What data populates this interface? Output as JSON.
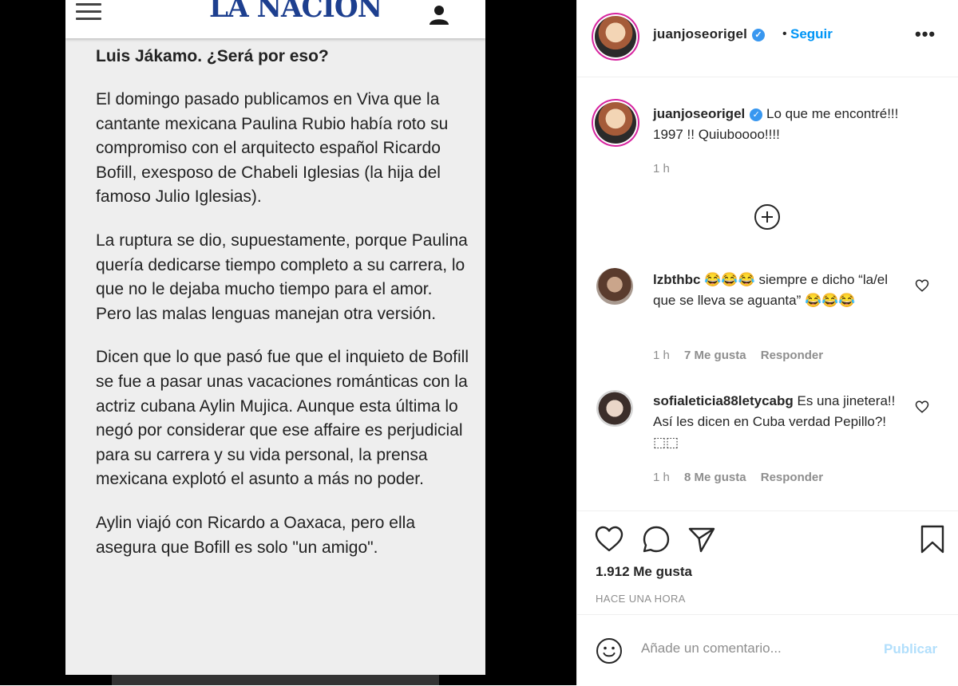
{
  "post_image": {
    "logo": "LA NACIÓN",
    "article": {
      "title": "Luis Jákamo. ¿Será por eso?",
      "paragraphs": [
        "El domingo pasado publicamos en Viva que la cantante mexicana Paulina Rubio había roto su compromiso con el arquitecto español Ricardo Bofill, exesposo de Chabeli Iglesias (la hija del famoso Julio Iglesias).",
        "La ruptura se dio, supuestamente, porque Paulina quería dedicarse tiempo completo a su carrera, lo que no le dejaba mucho tiempo para el amor. Pero las malas lenguas manejan otra versión.",
        "Dicen que lo que pasó fue que el inquieto de Bofill se fue a pasar unas vacaciones románticas con la actriz cubana Aylin Mujica. Aunque esta última lo negó por considerar que ese affaire es perjudicial para su carrera y su vida personal, la prensa mexicana explotó el asunto a más no poder.",
        "Aylin viajó con Ricardo a Oaxaca, pero ella asegura que Bofill es solo \"un amigo\"."
      ]
    }
  },
  "header": {
    "username": "juanjoseorigel",
    "verified_icon": "verified-badge-icon",
    "separator": "•",
    "follow_label": "Seguir",
    "more_icon": "•••"
  },
  "caption": {
    "username": "juanjoseorigel",
    "text": "Lo que me encontré!!! 1997 !! Quiuboooo!!!!",
    "time": "1 h"
  },
  "comments": [
    {
      "username": "lzbthbc",
      "text": "😂😂😂 siempre e dicho “la/el que se lleva se aguanta” 😂😂😂",
      "time": "1 h",
      "likes": "7 Me gusta",
      "reply": "Responder"
    },
    {
      "username": "sofialeticia88letycabg",
      "text": "Es una jinetera!! Así les dicen en Cuba verdad Pepillo?! ⬚⬚",
      "time": "1 h",
      "likes": "8 Me gusta",
      "reply": "Responder"
    }
  ],
  "actions": {
    "likes_count": "1.912 Me gusta",
    "posted_ago": "HACE UNA HORA"
  },
  "comment_box": {
    "placeholder": "Añade un comentario...",
    "publish_label": "Publicar"
  },
  "colors": {
    "accent": "#0095f6",
    "publish_disabled": "#b2dffc",
    "logo": "#1d3f8f"
  }
}
